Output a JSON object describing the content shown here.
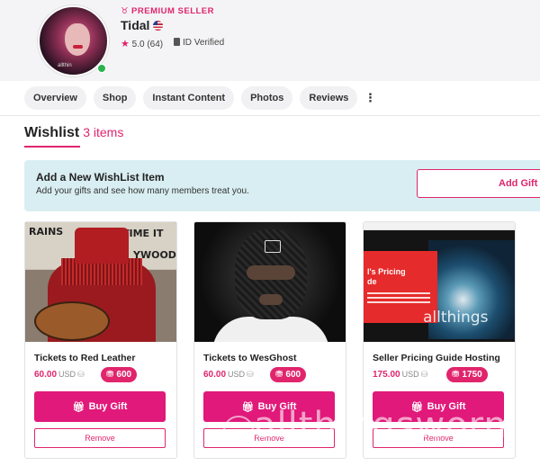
{
  "seller": {
    "badge": "PREMIUM SELLER",
    "name": "Tidal",
    "rating": "5.0 (64)",
    "verified": "ID Verified",
    "avatar_watermark": "allthin"
  },
  "tabs": [
    "Overview",
    "Shop",
    "Instant Content",
    "Photos",
    "Reviews"
  ],
  "wishlist": {
    "title": "Wishlist",
    "count": "3 items"
  },
  "add_box": {
    "title": "Add a New WishList Item",
    "subtitle": "Add your gifts and see how many members treat you.",
    "button": "Add Gift t"
  },
  "items": [
    {
      "name": "Tickets to Red Leather",
      "price": "60.00",
      "currency": "USD",
      "tokens": "600",
      "buy": "Buy Gift",
      "remove": "Remove"
    },
    {
      "name": "Tickets to WesGhost",
      "price": "60.00",
      "currency": "USD",
      "tokens": "600",
      "buy": "Buy Gift",
      "remove": "Remove"
    },
    {
      "name": "Seller Pricing Guide Hosting",
      "price": "175.00",
      "currency": "USD",
      "tokens": "1750",
      "buy": "Buy Gift",
      "remove": "Remove"
    }
  ],
  "image_texts": {
    "marquee_1": "RAINS",
    "marquee_2": "TIME IT",
    "marquee_3": "YWOOD",
    "pricing_heading": "l's Pricing\nde",
    "card_watermark": "allthings",
    "page_watermark": "allthingsworn"
  },
  "colors": {
    "accent": "#e0256d",
    "info_bg": "#d9eef2",
    "buy_button": "#e0197a"
  },
  "icons": [
    "crown-icon",
    "flag-us-icon",
    "star-icon",
    "id-card-icon",
    "more-icon",
    "coins-icon",
    "gift-icon"
  ]
}
